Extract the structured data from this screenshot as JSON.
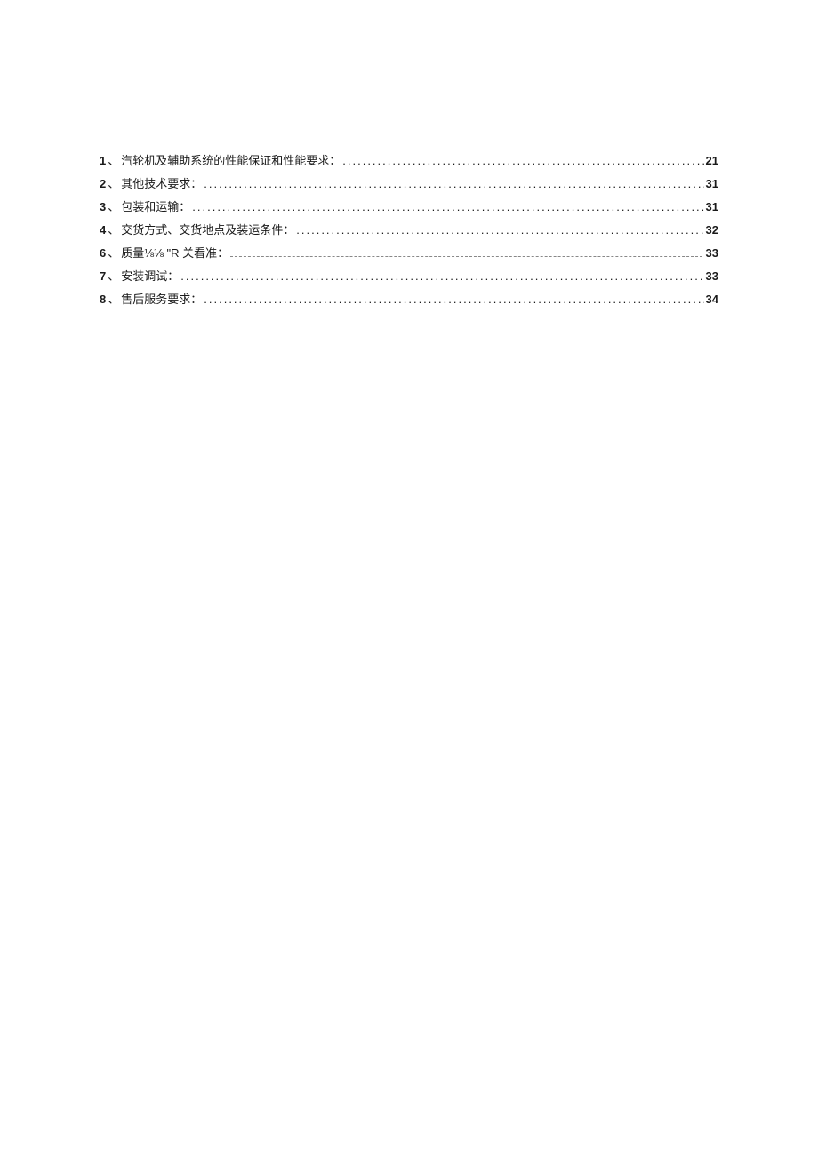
{
  "toc": {
    "entries": [
      {
        "num": "1",
        "separator": "、",
        "title": "汽轮机及辅助系统的性能保证和性能要求：",
        "page": "21",
        "garbled": false
      },
      {
        "num": "2",
        "separator": "、",
        "title": "其他技术要求：",
        "page": "31",
        "garbled": false
      },
      {
        "num": "3",
        "separator": "、",
        "title": "包装和运输：",
        "page": "31",
        "garbled": false
      },
      {
        "num": "4",
        "separator": "、",
        "title": "交货方式、交货地点及装运条件：",
        "page": "32",
        "garbled": false
      },
      {
        "num": "6",
        "separator": "、",
        "title": "质量⅛⅛ \"R 关看准：",
        "page": "33",
        "garbled": true
      },
      {
        "num": "7",
        "separator": "、",
        "title": "安装调试：",
        "page": "33",
        "garbled": false
      },
      {
        "num": "8",
        "separator": "、",
        "title": "售后服务要求：",
        "page": "34",
        "garbled": false
      }
    ]
  }
}
